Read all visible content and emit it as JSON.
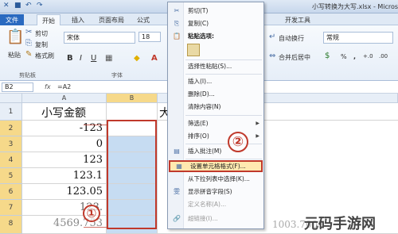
{
  "window": {
    "title": "小写转换为大写.xlsx - Microso",
    "quick_access": [
      "save-icon",
      "undo-icon",
      "redo-icon"
    ]
  },
  "tabs": [
    {
      "label": "文件",
      "kind": "file"
    },
    {
      "label": "开始",
      "kind": "active"
    },
    {
      "label": "插入"
    },
    {
      "label": "页面布局"
    },
    {
      "label": "公式"
    },
    {
      "label": "开发工具"
    }
  ],
  "ribbon": {
    "paste_label": "粘贴",
    "cut_label": "剪切",
    "copy_label": "复制",
    "format_painter_label": "格式刷",
    "clipboard_group": "剪贴板",
    "font_name": "宋体",
    "font_size": "18",
    "bold": "B",
    "italic": "I",
    "underline": "U",
    "font_group": "字体",
    "wrap_text_label": "自动换行",
    "merge_center_label": "合并后居中",
    "number_format": "常规",
    "percent": "%",
    "comma": ",",
    "inc_decimal": "+.0",
    "dec_decimal": ".00"
  },
  "formula_bar": {
    "name_box": "B2",
    "fx": "fx",
    "formula": "=A2"
  },
  "grid": {
    "columns": [
      "A",
      "B"
    ],
    "rows": [
      "1",
      "2",
      "3",
      "4",
      "5",
      "6",
      "7",
      "8"
    ],
    "header_A": "小写金额",
    "header_C_partial": "大",
    "values_A": [
      "-123",
      "0",
      "123",
      "123.1",
      "123.05",
      "123.",
      "4569.7"
    ],
    "values_A_suffix": [
      "",
      "",
      "",
      "",
      "",
      "",
      "53"
    ],
    "cell_C8_partial": "1003.7003"
  },
  "context_menu": {
    "items": [
      {
        "icon": "scissors-icon",
        "glyph": "✂",
        "label": "剪切(T)"
      },
      {
        "icon": "copy-icon",
        "glyph": "⎘",
        "label": "复制(C)"
      },
      {
        "icon": "paste-options-icon",
        "glyph": "📋",
        "label": "粘贴选项:"
      },
      {
        "icon": "",
        "glyph": "",
        "label": "选择性粘贴(S)..."
      },
      {
        "icon": "",
        "glyph": "",
        "label": "插入(I)..."
      },
      {
        "icon": "",
        "glyph": "",
        "label": "删除(D)..."
      },
      {
        "icon": "",
        "glyph": "",
        "label": "清除内容(N)"
      },
      {
        "icon": "",
        "glyph": "",
        "label": "筛选(E)",
        "submenu": true
      },
      {
        "icon": "",
        "glyph": "",
        "label": "排序(O)",
        "submenu": true
      },
      {
        "icon": "insert-comment-icon",
        "glyph": "▤",
        "label": "插入批注(M)"
      },
      {
        "icon": "format-cells-icon",
        "glyph": "▦",
        "label": "设置单元格格式(F)...",
        "highlight": true
      },
      {
        "icon": "",
        "glyph": "",
        "label": "从下拉列表中选择(K)..."
      },
      {
        "icon": "phonetic-icon",
        "glyph": "雯",
        "label": "显示拼音字段(S)"
      },
      {
        "icon": "",
        "glyph": "",
        "label": "定义名称(A)...",
        "dim": true
      },
      {
        "icon": "hyperlink-icon",
        "glyph": "🔗",
        "label": "超链接(I)...",
        "dim": true
      }
    ]
  },
  "annotations": {
    "step_one": "①",
    "step_two": "②"
  },
  "watermark": "元码手游网",
  "colors": {
    "accent": "#c0392b",
    "selection": "#c6dcf2",
    "file_tab": "#2a6ac0"
  }
}
